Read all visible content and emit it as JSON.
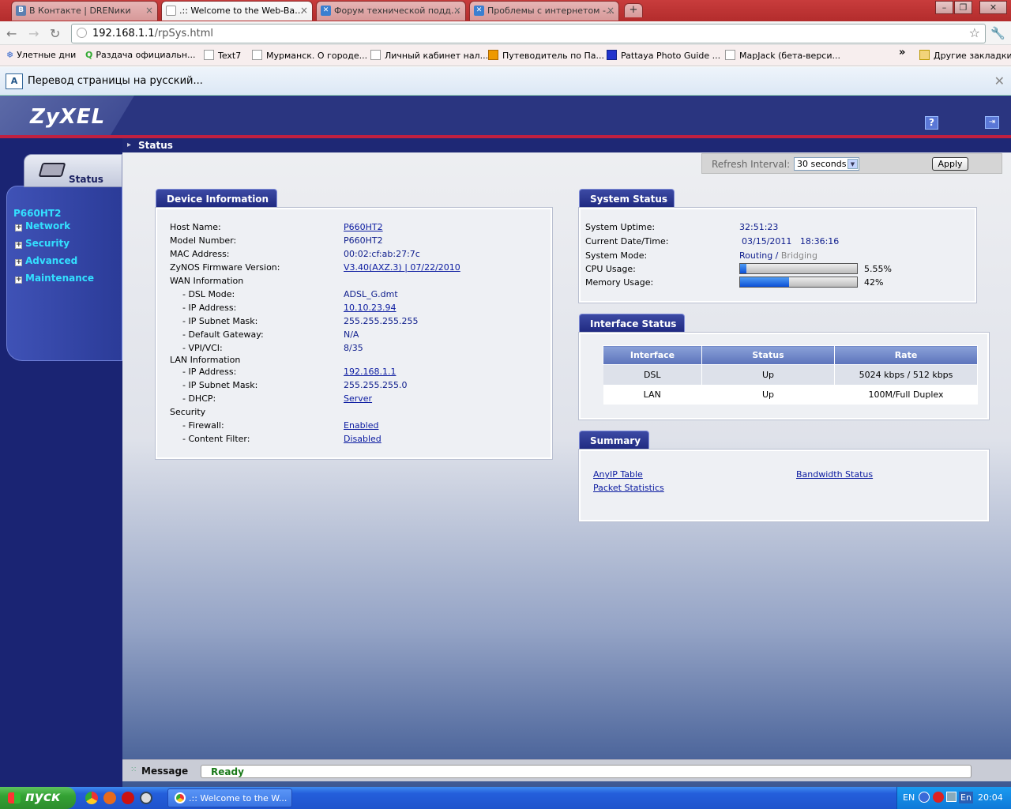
{
  "browser": {
    "tabs": [
      {
        "title": "В Контакте | DRENики",
        "active": false
      },
      {
        "title": ".:: Welcome to the Web-Ba…",
        "active": true
      },
      {
        "title": "Форум технической подд…",
        "active": false
      },
      {
        "title": "Проблемы с интернетом -…",
        "active": false
      }
    ],
    "url_host": "192.168.1.1",
    "url_path": "/rpSys.html",
    "bookmarks": [
      "Улетные дни",
      "Раздача официальн...",
      "Text7",
      "Мурманск. О городе...",
      "Личный кабинет нал...",
      "Путеводитель по Па...",
      "Pattaya Photo Guide ...",
      "MapJack (бета-верси..."
    ],
    "bookmarks_overflow": "»",
    "other_bookmarks": "Другие закладки",
    "infobar_text": "Перевод страницы на русский..."
  },
  "header": {
    "logo": "ZyXEL",
    "help_icon": "?",
    "logout_icon": "logout-icon"
  },
  "sidebar": {
    "tab_label": "Status",
    "model": "P660HT2",
    "items": [
      "Network",
      "Security",
      "Advanced",
      "Maintenance"
    ]
  },
  "page": {
    "title": "Status",
    "refresh_label": "Refresh Interval:",
    "refresh_value": "30 seconds",
    "apply_label": "Apply"
  },
  "device_info": {
    "title": "Device Information",
    "rows": [
      {
        "label": "Host Name:",
        "value": "P660HT2"
      },
      {
        "label": "Model Number:",
        "value": "P660HT2"
      },
      {
        "label": "MAC Address:",
        "value": "00:02:cf:ab:27:7c"
      },
      {
        "label": "ZyNOS Firmware Version:",
        "value": "V3.40(AXZ.3) | 07/22/2010"
      },
      {
        "label": "WAN Information",
        "value": ""
      },
      {
        "label": "- DSL Mode:",
        "value": "ADSL_G.dmt"
      },
      {
        "label": "- IP Address:",
        "value": "10.10.23.94"
      },
      {
        "label": "- IP Subnet Mask:",
        "value": "255.255.255.255"
      },
      {
        "label": "- Default Gateway:",
        "value": "N/A"
      },
      {
        "label": "- VPI/VCI:",
        "value": "8/35"
      },
      {
        "label": "LAN Information",
        "value": ""
      },
      {
        "label": "- IP Address:",
        "value": "192.168.1.1"
      },
      {
        "label": "- IP Subnet Mask:",
        "value": "255.255.255.0"
      },
      {
        "label": "- DHCP:",
        "value": "Server"
      },
      {
        "label": "Security",
        "value": ""
      },
      {
        "label": "- Firewall:",
        "value": "Enabled"
      },
      {
        "label": "- Content Filter:",
        "value": "Disabled"
      }
    ]
  },
  "system_status": {
    "title": "System Status",
    "uptime_label": "System Uptime:",
    "uptime": "32:51:23",
    "datetime_label": "Current Date/Time:",
    "datetime": "03/15/2011   18:36:16",
    "mode_label": "System Mode:",
    "mode_routing": "Routing",
    "mode_sep": " / ",
    "mode_bridging": "Bridging",
    "cpu_label": "CPU Usage:",
    "cpu_pct_text": "5.55%",
    "cpu_fraction": 0.0555,
    "mem_label": "Memory Usage:",
    "mem_pct_text": "42%",
    "mem_fraction": 0.42
  },
  "interface_status": {
    "title": "Interface Status",
    "headers": [
      "Interface",
      "Status",
      "Rate"
    ],
    "rows": [
      [
        "DSL",
        "Up",
        "5024 kbps / 512 kbps"
      ],
      [
        "LAN",
        "Up",
        "100M/Full Duplex"
      ]
    ]
  },
  "summary": {
    "title": "Summary",
    "links": [
      "AnyIP Table",
      "Bandwidth Status",
      "Packet Statistics"
    ]
  },
  "message": {
    "label": "Message",
    "value": "Ready"
  },
  "taskbar": {
    "start_label": "пуск",
    "task_label": ".:: Welcome to the W...",
    "lang": "EN",
    "lang2": "En",
    "clock": "20:04"
  }
}
